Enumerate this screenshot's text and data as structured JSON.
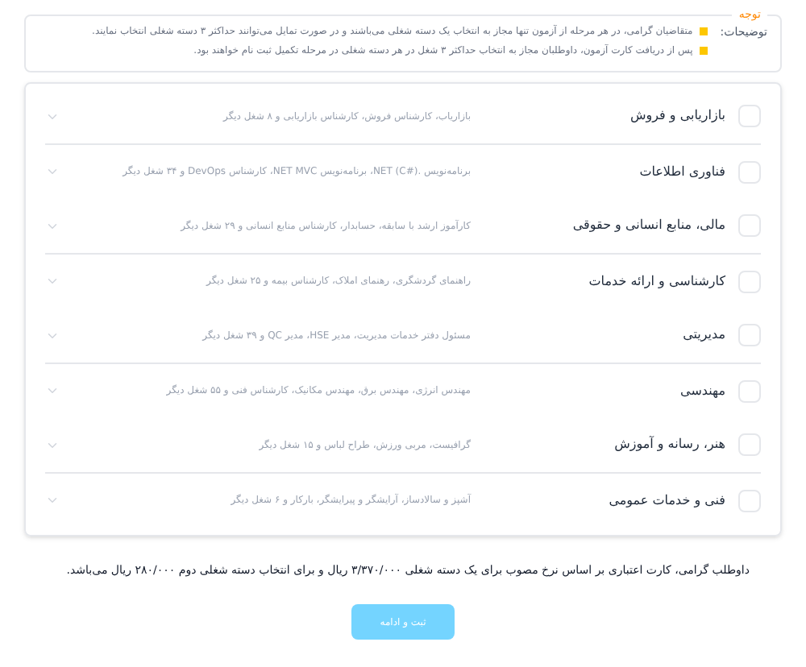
{
  "notes": {
    "legend": "توجه",
    "label": "توضیحات:",
    "items": [
      "متقاضیان گرامی، در هر مرحله از آزمون تنها مجاز به انتخاب یک دسته شغلی می‌باشند و در صورت تمایل می‌توانند حداکثر ۳ دسته شغلی انتخاب نمایند.",
      "پس از دریافت کارت آزمون، داوطلبان مجاز به انتخاب حداکثر ۳ شغل در هر دسته شغلی در مرحله تکمیل ثبت نام خواهند بود."
    ]
  },
  "categories": [
    {
      "title": "بازاریابی و فروش",
      "jobs": "بازاریاب، کارشناس فروش، کارشناس بازاریابی و ۸ شغل دیگر",
      "checked": false
    },
    {
      "title": "فناوری اطلاعات",
      "jobs": "برنامه‌نویس .NET (C#)، برنامه‌نویس NET MVC، کارشناس DevOps و ۳۴ شغل دیگر",
      "checked": false
    },
    {
      "title": "مالی، منابع انسانی و حقوقی",
      "jobs": "کارآموز ارشد با سابقه، حسابدار، کارشناس منابع انسانی و ۲۹ شغل دیگر",
      "checked": false
    },
    {
      "title": "کارشناسی و ارائه خدمات",
      "jobs": "راهنمای گردشگری، رهنمای املاک، کارشناس بیمه و ۲۵ شغل دیگر",
      "checked": false
    },
    {
      "title": "مدیریتی",
      "jobs": "مسئول دفتر خدمات مدیریت، مدیر HSE، مدیر QC و ۳۹ شغل دیگر",
      "checked": false
    },
    {
      "title": "مهندسی",
      "jobs": "مهندس انرژی، مهندس برق، مهندس مکانیک، کارشناس فنی و ۵۵ شغل دیگر",
      "checked": false
    },
    {
      "title": "هنر، رسانه و آموزش",
      "jobs": "گرافیست، مربی ورزش، طراح لباس و ۱۵ شغل دیگر",
      "checked": false
    },
    {
      "title": "فنی و خدمات عمومی",
      "jobs": "آشپز و سالادساز، آرایشگر و پیرایشگر، بارکار و ۶ شغل دیگر",
      "checked": false
    }
  ],
  "fee_note": "داوطلب گرامی، کارت اعتباری بر اساس نرخ مصوب برای یک دسته شغلی ۳/۳۷۰/۰۰۰ ریال و برای انتخاب دسته شغلی دوم ۲۸۰/۰۰۰ ریال می‌باشد.",
  "submit": "ثبت و ادامه"
}
